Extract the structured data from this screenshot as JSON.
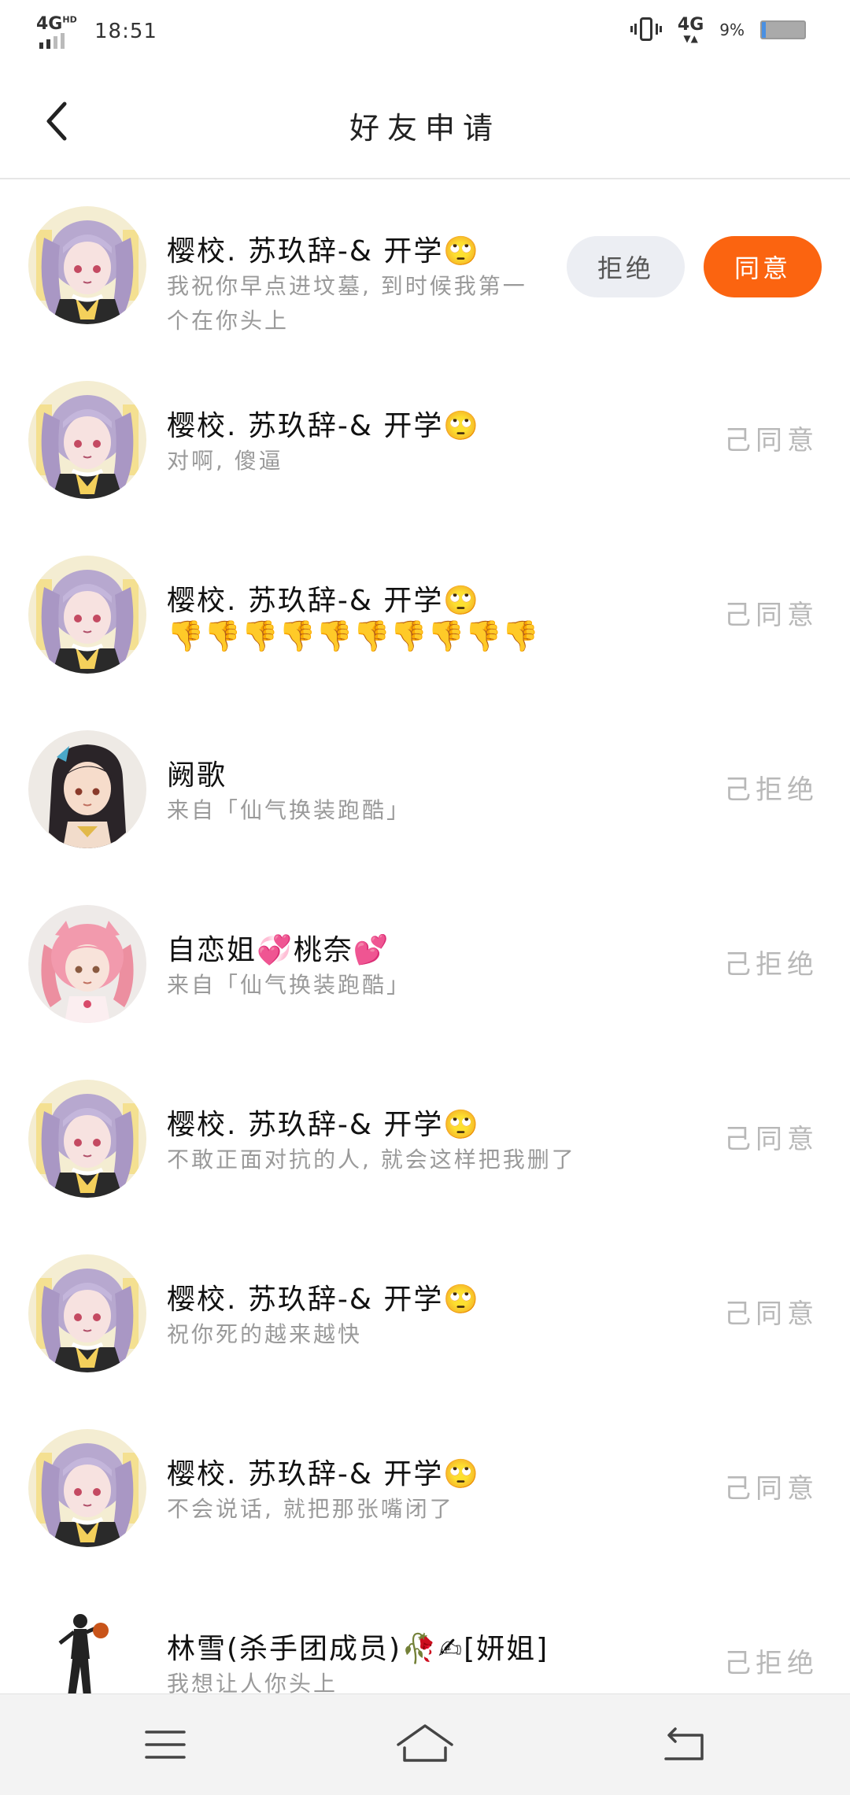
{
  "status_bar": {
    "network": "4G",
    "network_sup": "HD",
    "time": "18:51",
    "network2": "4G",
    "battery_pct": "9%"
  },
  "header": {
    "title": "好友申请"
  },
  "requests": [
    {
      "name": "樱校. 苏玖辞-& 开学🙄",
      "message": "我祝你早点进坟墓, 到时候我第一个在你头上",
      "status": "",
      "avatar": "purple-twintail-girl"
    },
    {
      "name": "樱校. 苏玖辞-& 开学🙄",
      "message": "对啊, 傻逼",
      "status": "己同意",
      "avatar": "purple-twintail-girl"
    },
    {
      "name": "樱校. 苏玖辞-& 开学🙄",
      "message": "👎👎👎👎👎👎👎👎👎👎",
      "status": "己同意",
      "avatar": "purple-twintail-girl"
    },
    {
      "name": "阙歌",
      "message": "来自「仙气换装跑酷」",
      "status": "己拒绝",
      "avatar": "black-hair-girl"
    },
    {
      "name": "自恋姐💞桃奈💕",
      "message": "来自「仙气换装跑酷」",
      "status": "己拒绝",
      "avatar": "pink-hair-girl"
    },
    {
      "name": "樱校. 苏玖辞-& 开学🙄",
      "message": "不敢正面对抗的人, 就会这样把我删了",
      "status": "己同意",
      "avatar": "purple-twintail-girl"
    },
    {
      "name": "樱校. 苏玖辞-& 开学🙄",
      "message": "祝你死的越来越快",
      "status": "己同意",
      "avatar": "purple-twintail-girl"
    },
    {
      "name": "樱校. 苏玖辞-& 开学🙄",
      "message": "不会说话, 就把那张嘴闭了",
      "status": "己同意",
      "avatar": "purple-twintail-girl"
    },
    {
      "name": "林雪(杀手团成员)🥀✍[妍姐]",
      "message": "我想让人你头上",
      "status": "己拒绝",
      "avatar": "dancer-figure"
    }
  ],
  "buttons": {
    "reject": "拒绝",
    "accept": "同意"
  },
  "nav": {
    "menu_icon": "menu-icon",
    "home_icon": "home-icon",
    "back_icon": "return-icon"
  },
  "colors": {
    "accent": "#fb6410",
    "reject_bg": "#eceef3",
    "status_text": "#b8b8b8"
  }
}
